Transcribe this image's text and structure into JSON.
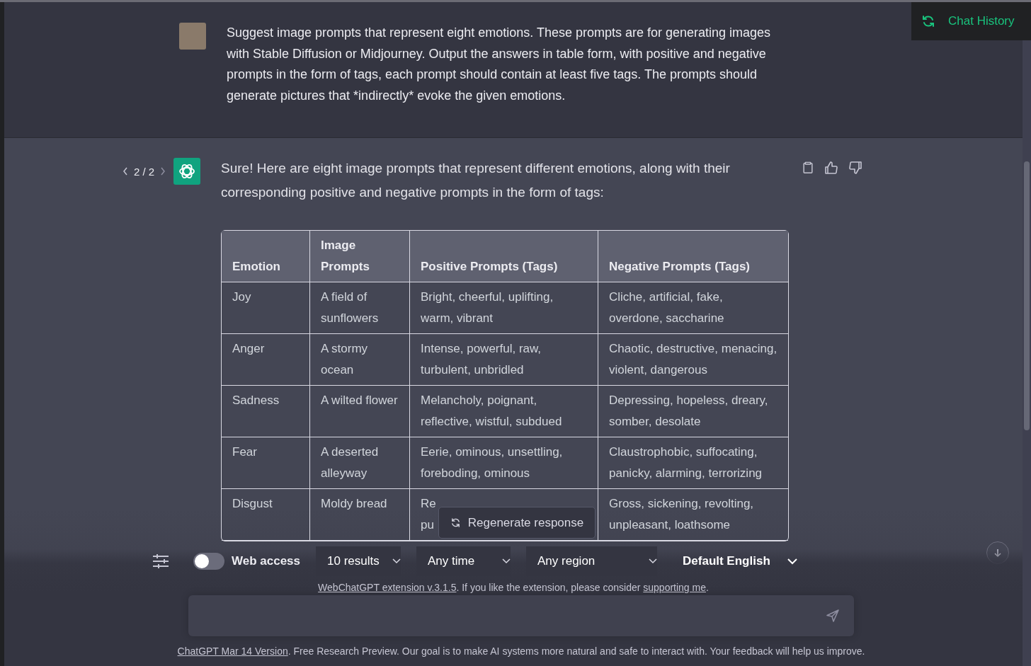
{
  "chat_history_button": {
    "label": "Chat History"
  },
  "user_message": {
    "text": "Suggest image prompts that represent eight emotions. These prompts are for generating images with Stable Diffusion or Midjourney. Output the answers in table form, with positive and negative prompts in the form of tags, each prompt should contain at least five tags. The prompts should generate pictures that *indirectly* evoke the given emotions."
  },
  "assistant_message": {
    "pager": "2 / 2",
    "intro": "Sure! Here are eight image prompts that represent different emotions, along with their corresponding positive and negative prompts in the form of tags:",
    "table": {
      "columns": [
        "Emotion",
        "Image Prompts",
        "Positive Prompts (Tags)",
        "Negative Prompts (Tags)"
      ],
      "rows": [
        [
          "Joy",
          "A field of sunflowers",
          "Bright, cheerful, uplifting, warm, vibrant",
          "Cliche, artificial, fake, overdone, saccharine"
        ],
        [
          "Anger",
          "A stormy ocean",
          "Intense, powerful, raw, turbulent, unbridled",
          "Chaotic, destructive, menacing, violent, dangerous"
        ],
        [
          "Sadness",
          "A wilted flower",
          "Melancholy, poignant, reflective, wistful, subdued",
          "Depressing, hopeless, dreary, somber, desolate"
        ],
        [
          "Fear",
          "A deserted alleyway",
          "Eerie, ominous, unsettling, foreboding, ominous",
          "Claustrophobic, suffocating, panicky, alarming, terrorizing"
        ],
        [
          "Disgust",
          "Moldy bread",
          "Re\npu",
          "Gross, sickening, revolting, unpleasant, loathsome"
        ]
      ]
    }
  },
  "regenerate_button": {
    "label": "Regenerate response"
  },
  "toolbar": {
    "web_access": {
      "label": "Web access",
      "on": false
    },
    "selects": [
      "10 results",
      "Any time",
      "Any region"
    ],
    "language": "Default English"
  },
  "extension_note": {
    "link": "WebChatGPT extension v.3.1.5",
    "text": ". If you like the extension, please consider ",
    "link2": "supporting me",
    "end": "."
  },
  "footer": {
    "link": "ChatGPT Mar 14 Version",
    "text": ". Free Research Preview. Our goal is to make AI systems more natural and safe to interact with. Your feedback will help us improve."
  }
}
